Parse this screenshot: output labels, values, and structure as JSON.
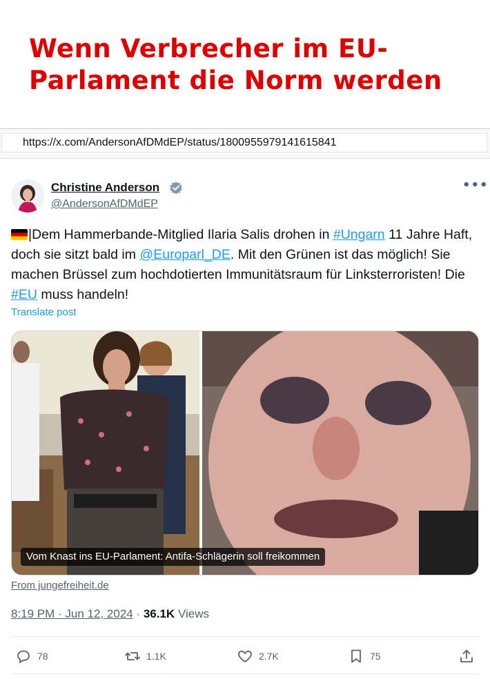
{
  "headline": {
    "line1": "Wenn Verbrecher im EU-",
    "line2": "Parlament die Norm werden",
    "color": "#e00000"
  },
  "url_bar": {
    "url": "https://x.com/AndersonAfDMdEP/status/1800955979141615841"
  },
  "post": {
    "author_name": "Christine Anderson",
    "handle": "@AndersonAfDMdEP",
    "verified": true,
    "more_icon": "more-horizontal-icon",
    "text": {
      "flag": "german-flag-icon",
      "part1": "|Dem Hammerbande-Mitglied Ilaria Salis drohen in ",
      "hashtag1": "#Ungarn",
      "part2": " 11 Jahre Haft, doch sie sitzt bald im  ",
      "mention": "@Europarl_DE",
      "part3": ". Mit den Grünen ist das möglich! Sie machen Brüssel zum hochdotierten Immunitätsraum für Linksterroristen! Die ",
      "hashtag2": "#EU",
      "part4": " muss handeln!"
    },
    "translate_label": "Translate post",
    "media_caption": "Vom Knast ins EU-Parlament: Antifa-Schlägerin soll freikommen",
    "source_label": "From jungefreiheit.de",
    "timestamp": "8:19 PM · Jun 12, 2024",
    "separator": " · ",
    "views_count": "36.1K",
    "views_label": " Views",
    "link_color": "#1d9bf0"
  },
  "actions": {
    "replies": "78",
    "reposts": "1.1K",
    "likes": "2.7K",
    "bookmarks": "75"
  }
}
